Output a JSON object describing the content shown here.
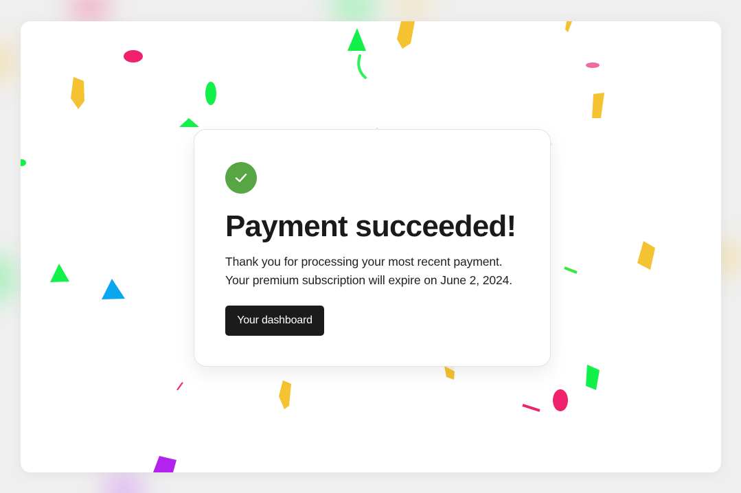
{
  "card": {
    "title": "Payment succeeded!",
    "message_line1": "Thank you for processing your most recent payment.",
    "message_line2": "Your premium subscription will expire on June 2, 2024.",
    "dashboard_button_label": "Your dashboard"
  },
  "colors": {
    "success_green": "#58a545",
    "button_bg": "#1b1b1b",
    "confetti_yellow": "#f5c231",
    "confetti_green": "#12f04a",
    "confetti_pink": "#f0226e",
    "confetti_blue": "#0aa6f0",
    "confetti_purple": "#b223f0"
  },
  "icons": {
    "status": "checkmark-icon"
  }
}
